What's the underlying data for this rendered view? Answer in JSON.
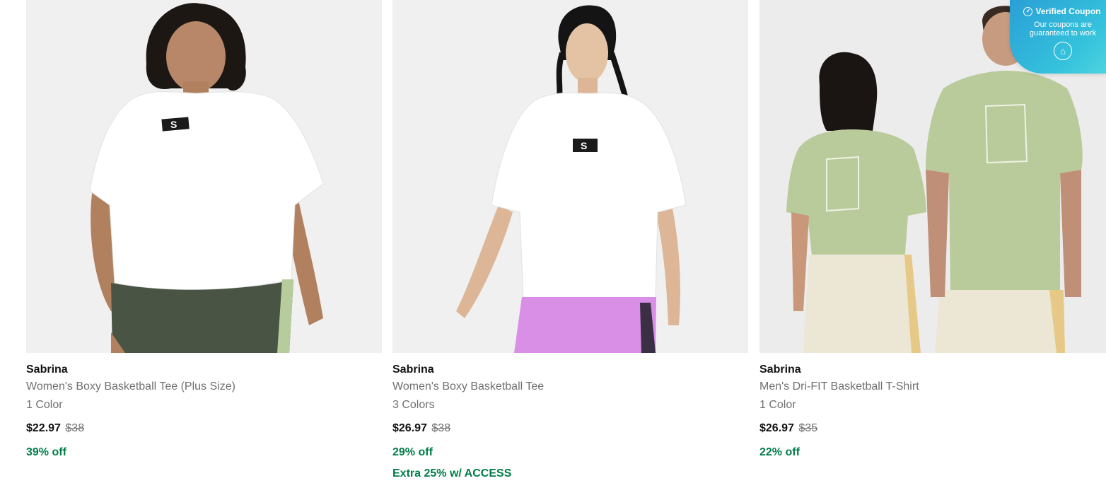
{
  "products": [
    {
      "title": "Sabrina",
      "subtitle": "Women's Boxy Basketball Tee (Plus Size)",
      "colors": "1 Color",
      "price_now": "$22.97",
      "price_was": "$38",
      "discount": "39% off",
      "extra": "",
      "shirt_color": "#ffffff",
      "shorts_color": "#4a5444"
    },
    {
      "title": "Sabrina",
      "subtitle": "Women's Boxy Basketball Tee",
      "colors": "3 Colors",
      "price_now": "$26.97",
      "price_was": "$38",
      "discount": "29% off",
      "extra": "Extra 25% w/ ACCESS",
      "shirt_color": "#ffffff",
      "shorts_color": "#d98fe6"
    },
    {
      "title": "Sabrina",
      "subtitle": "Men's Dri-FIT Basketball T-Shirt",
      "colors": "1 Color",
      "price_now": "$26.97",
      "price_was": "$35",
      "discount": "22% off",
      "extra": "",
      "shirt_color": "#b9cb9a",
      "shorts_color": "#ece6d4"
    }
  ],
  "coupon": {
    "heading": "Verified Coupon",
    "line1": "Our coupons are",
    "line2": "guaranteed to work",
    "check_icon": "✓",
    "logo_icon": "⌂"
  },
  "colors": {
    "discount_green": "#007d48",
    "muted_text": "#707072",
    "image_bg": "#f0f0f0",
    "coupon_blue": "#2a9fd6"
  }
}
